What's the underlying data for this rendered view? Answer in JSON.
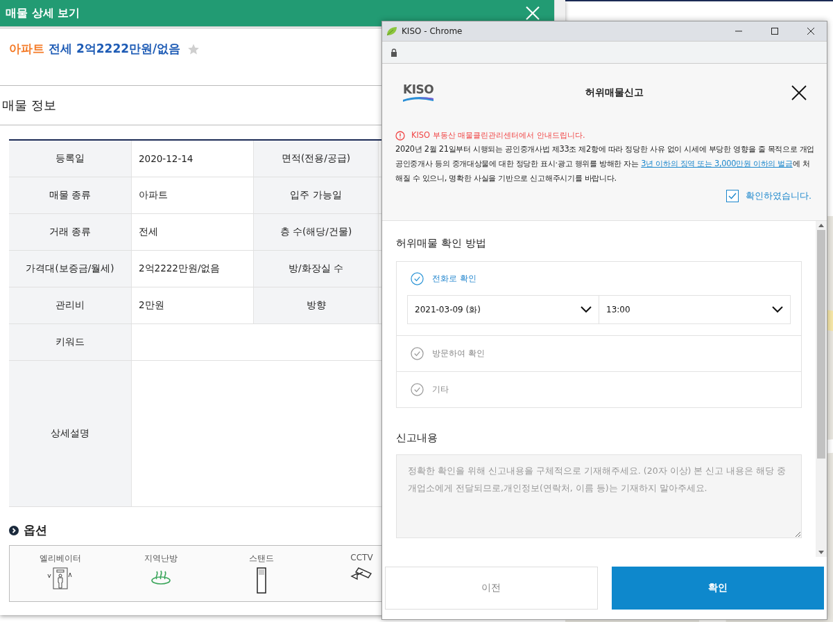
{
  "detail_window": {
    "title": "매물 상세 보기"
  },
  "listing": {
    "type": "아파트",
    "summary": "전세 2억2222만원/없음",
    "favorite": false
  },
  "info_title": "매물 정보",
  "info_rows": [
    {
      "kind": "pair",
      "label": "등록일",
      "value": "2020-12-14",
      "label_2": "면적(전용/공급)"
    },
    {
      "kind": "pair",
      "label": "매물 종류",
      "value": "아파트",
      "label_2": "입주 가능일"
    },
    {
      "kind": "pair",
      "label": "거래 종류",
      "value": "전세",
      "label_2": "층 수(해당/건물)"
    },
    {
      "kind": "pair",
      "label": "가격대(보증금/월세)",
      "value": "2억2222만원/없음",
      "label_2": "방/화장실 수"
    },
    {
      "kind": "pair",
      "label": "관리비",
      "value": "2만원",
      "label_2": "방향"
    },
    {
      "kind": "wide",
      "label": "키워드"
    },
    {
      "kind": "tall",
      "label": "상세설명"
    }
  ],
  "options_title": "옵션",
  "options": [
    {
      "kind": "elevator",
      "label": "엘리베이터"
    },
    {
      "kind": "heating",
      "label": "지역난방"
    },
    {
      "kind": "stand",
      "label": "스탠드"
    },
    {
      "kind": "cctv",
      "label": "CCTV"
    }
  ],
  "popup": {
    "browser_title": "KISO - Chrome",
    "logo": "KISO",
    "title": "허위매물신고",
    "notice_heading": "KISO 부동산 매물클린관리센터에서 안내드립니다.",
    "notice_text": "2020년 2월 21일부터 시행되는 공인중개사법 제33조 제2항에 따라 정당한 사유 없이 시세에 부당한 영향을 줄 목적으로 개업공인중개사 등의 중개대상물에 대한 정당한 표시·광고 행위를 방해한 자는 ",
    "notice_link": "3년 이하의 징역 또는 3,000만원 이하의 벌금",
    "notice_tail": "에 처해질 수 있으니, 명확한 사실을 기반으로 신고해주시기를 바랍니다.",
    "confirm": {
      "label": "확인하였습니다.",
      "checked": true
    },
    "method_title": "허위매물 확인 방법",
    "methods": [
      {
        "label": "전화로 확인",
        "selected": true,
        "date_select": "2021-03-09 (화)",
        "time_select": "13:00"
      },
      {
        "label": "방문하여 확인",
        "selected": false
      },
      {
        "label": "기타",
        "selected": false
      }
    ],
    "content_title": "신고내용",
    "content_placeholder": "정확한 확인을 위해 신고내용을 구체적으로 기재해주세요. (20자 이상) 본 신고 내용은 해당 중개업소에게 전달되므로,개인정보(연락처, 이름 등)는 기재하지 말아주세요.",
    "buttons": [
      {
        "label": "이전",
        "kind": "secondary"
      },
      {
        "label": "확인",
        "kind": "primary"
      }
    ]
  }
}
